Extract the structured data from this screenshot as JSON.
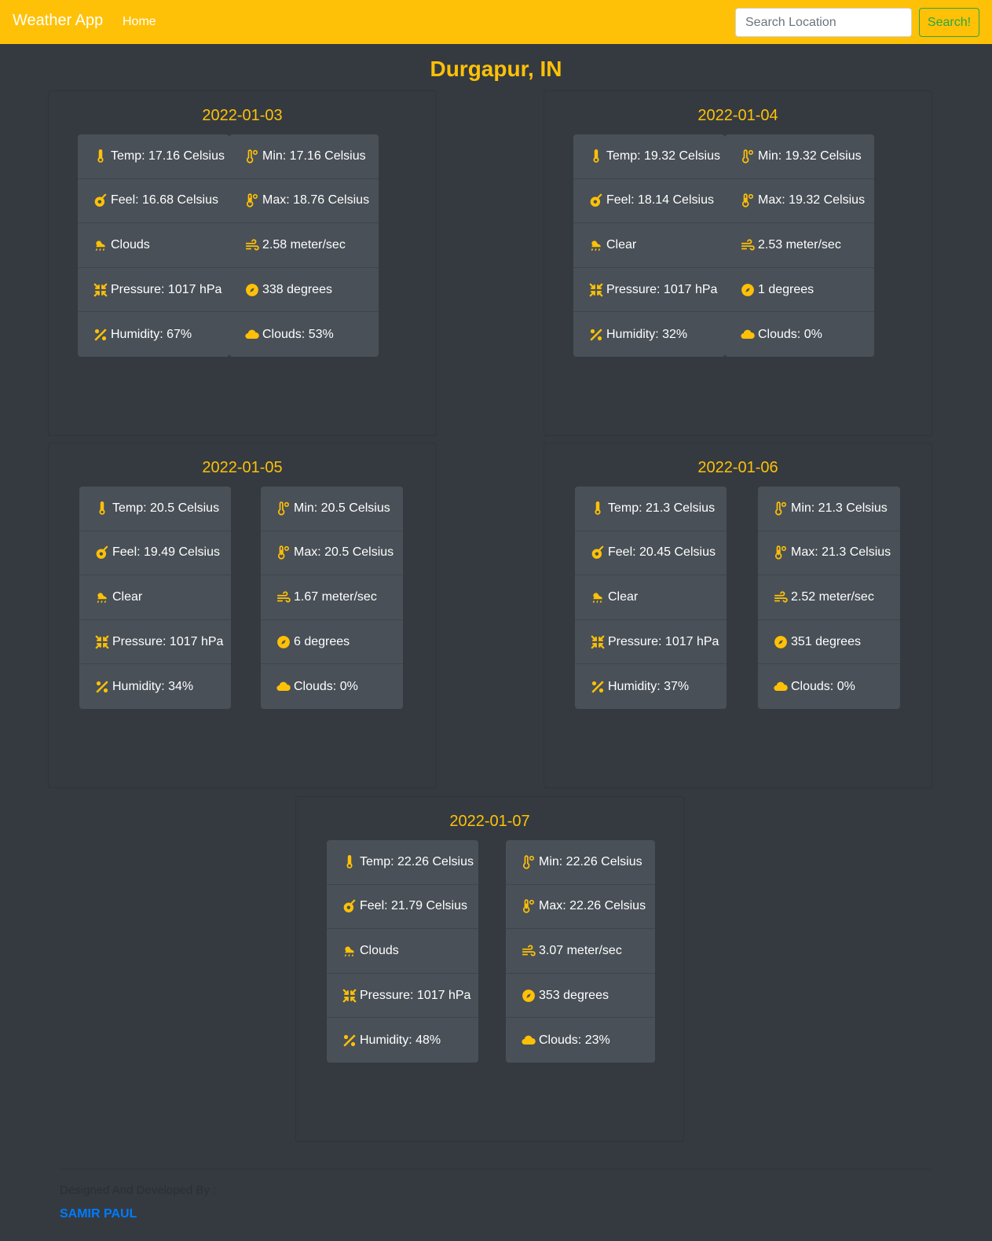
{
  "nav": {
    "brand": "Weather App",
    "home": "Home",
    "search_placeholder": "Search Location",
    "search_button": "Search!"
  },
  "city": "Durgapur, IN",
  "days": [
    {
      "date": "2022-01-03",
      "left": [
        "Temp: 17.16 Celsius",
        "Feel: 16.68 Celsius",
        "Clouds",
        "Pressure: 1017 hPa",
        "Humidity: 67%"
      ],
      "right": [
        "Min: 17.16 Celsius",
        "Max: 18.76 Celsius",
        "2.58 meter/sec",
        "338 degrees",
        "Clouds: 53%"
      ]
    },
    {
      "date": "2022-01-04",
      "left": [
        "Temp: 19.32 Celsius",
        "Feel: 18.14 Celsius",
        "Clear",
        "Pressure: 1017 hPa",
        "Humidity: 32%"
      ],
      "right": [
        "Min: 19.32 Celsius",
        "Max: 19.32 Celsius",
        "2.53 meter/sec",
        "1 degrees",
        "Clouds: 0%"
      ]
    },
    {
      "date": "2022-01-05",
      "left": [
        "Temp: 20.5 Celsius",
        "Feel: 19.49 Celsius",
        "Clear",
        "Pressure: 1017 hPa",
        "Humidity: 34%"
      ],
      "right": [
        "Min: 20.5 Celsius",
        "Max: 20.5 Celsius",
        "1.67 meter/sec",
        "6 degrees",
        "Clouds: 0%"
      ]
    },
    {
      "date": "2022-01-06",
      "left": [
        "Temp: 21.3 Celsius",
        "Feel: 20.45 Celsius",
        "Clear",
        "Pressure: 1017 hPa",
        "Humidity: 37%"
      ],
      "right": [
        "Min: 21.3 Celsius",
        "Max: 21.3 Celsius",
        "2.52 meter/sec",
        "351 degrees",
        "Clouds: 0%"
      ]
    },
    {
      "date": "2022-01-07",
      "left": [
        "Temp: 22.26 Celsius",
        "Feel: 21.79 Celsius",
        "Clouds",
        "Pressure: 1017 hPa",
        "Humidity: 48%"
      ],
      "right": [
        "Min: 22.26 Celsius",
        "Max: 22.26 Celsius",
        "3.07 meter/sec",
        "353 degrees",
        "Clouds: 23%"
      ]
    }
  ],
  "icons": {
    "left": [
      "thermometer-icon",
      "feel-icon",
      "weather-icon",
      "pressure-icon",
      "humidity-icon"
    ],
    "right": [
      "min-temp-icon",
      "max-temp-icon",
      "wind-icon",
      "compass-icon",
      "cloud-icon"
    ]
  },
  "footer": {
    "credit": "Designed And Developed By :",
    "author": "SAMIR PAUL"
  },
  "colors": {
    "accent": "#ffc107",
    "background": "#343a40",
    "panel": "#495057",
    "search_button": "#28a745",
    "link": "#007bff"
  }
}
